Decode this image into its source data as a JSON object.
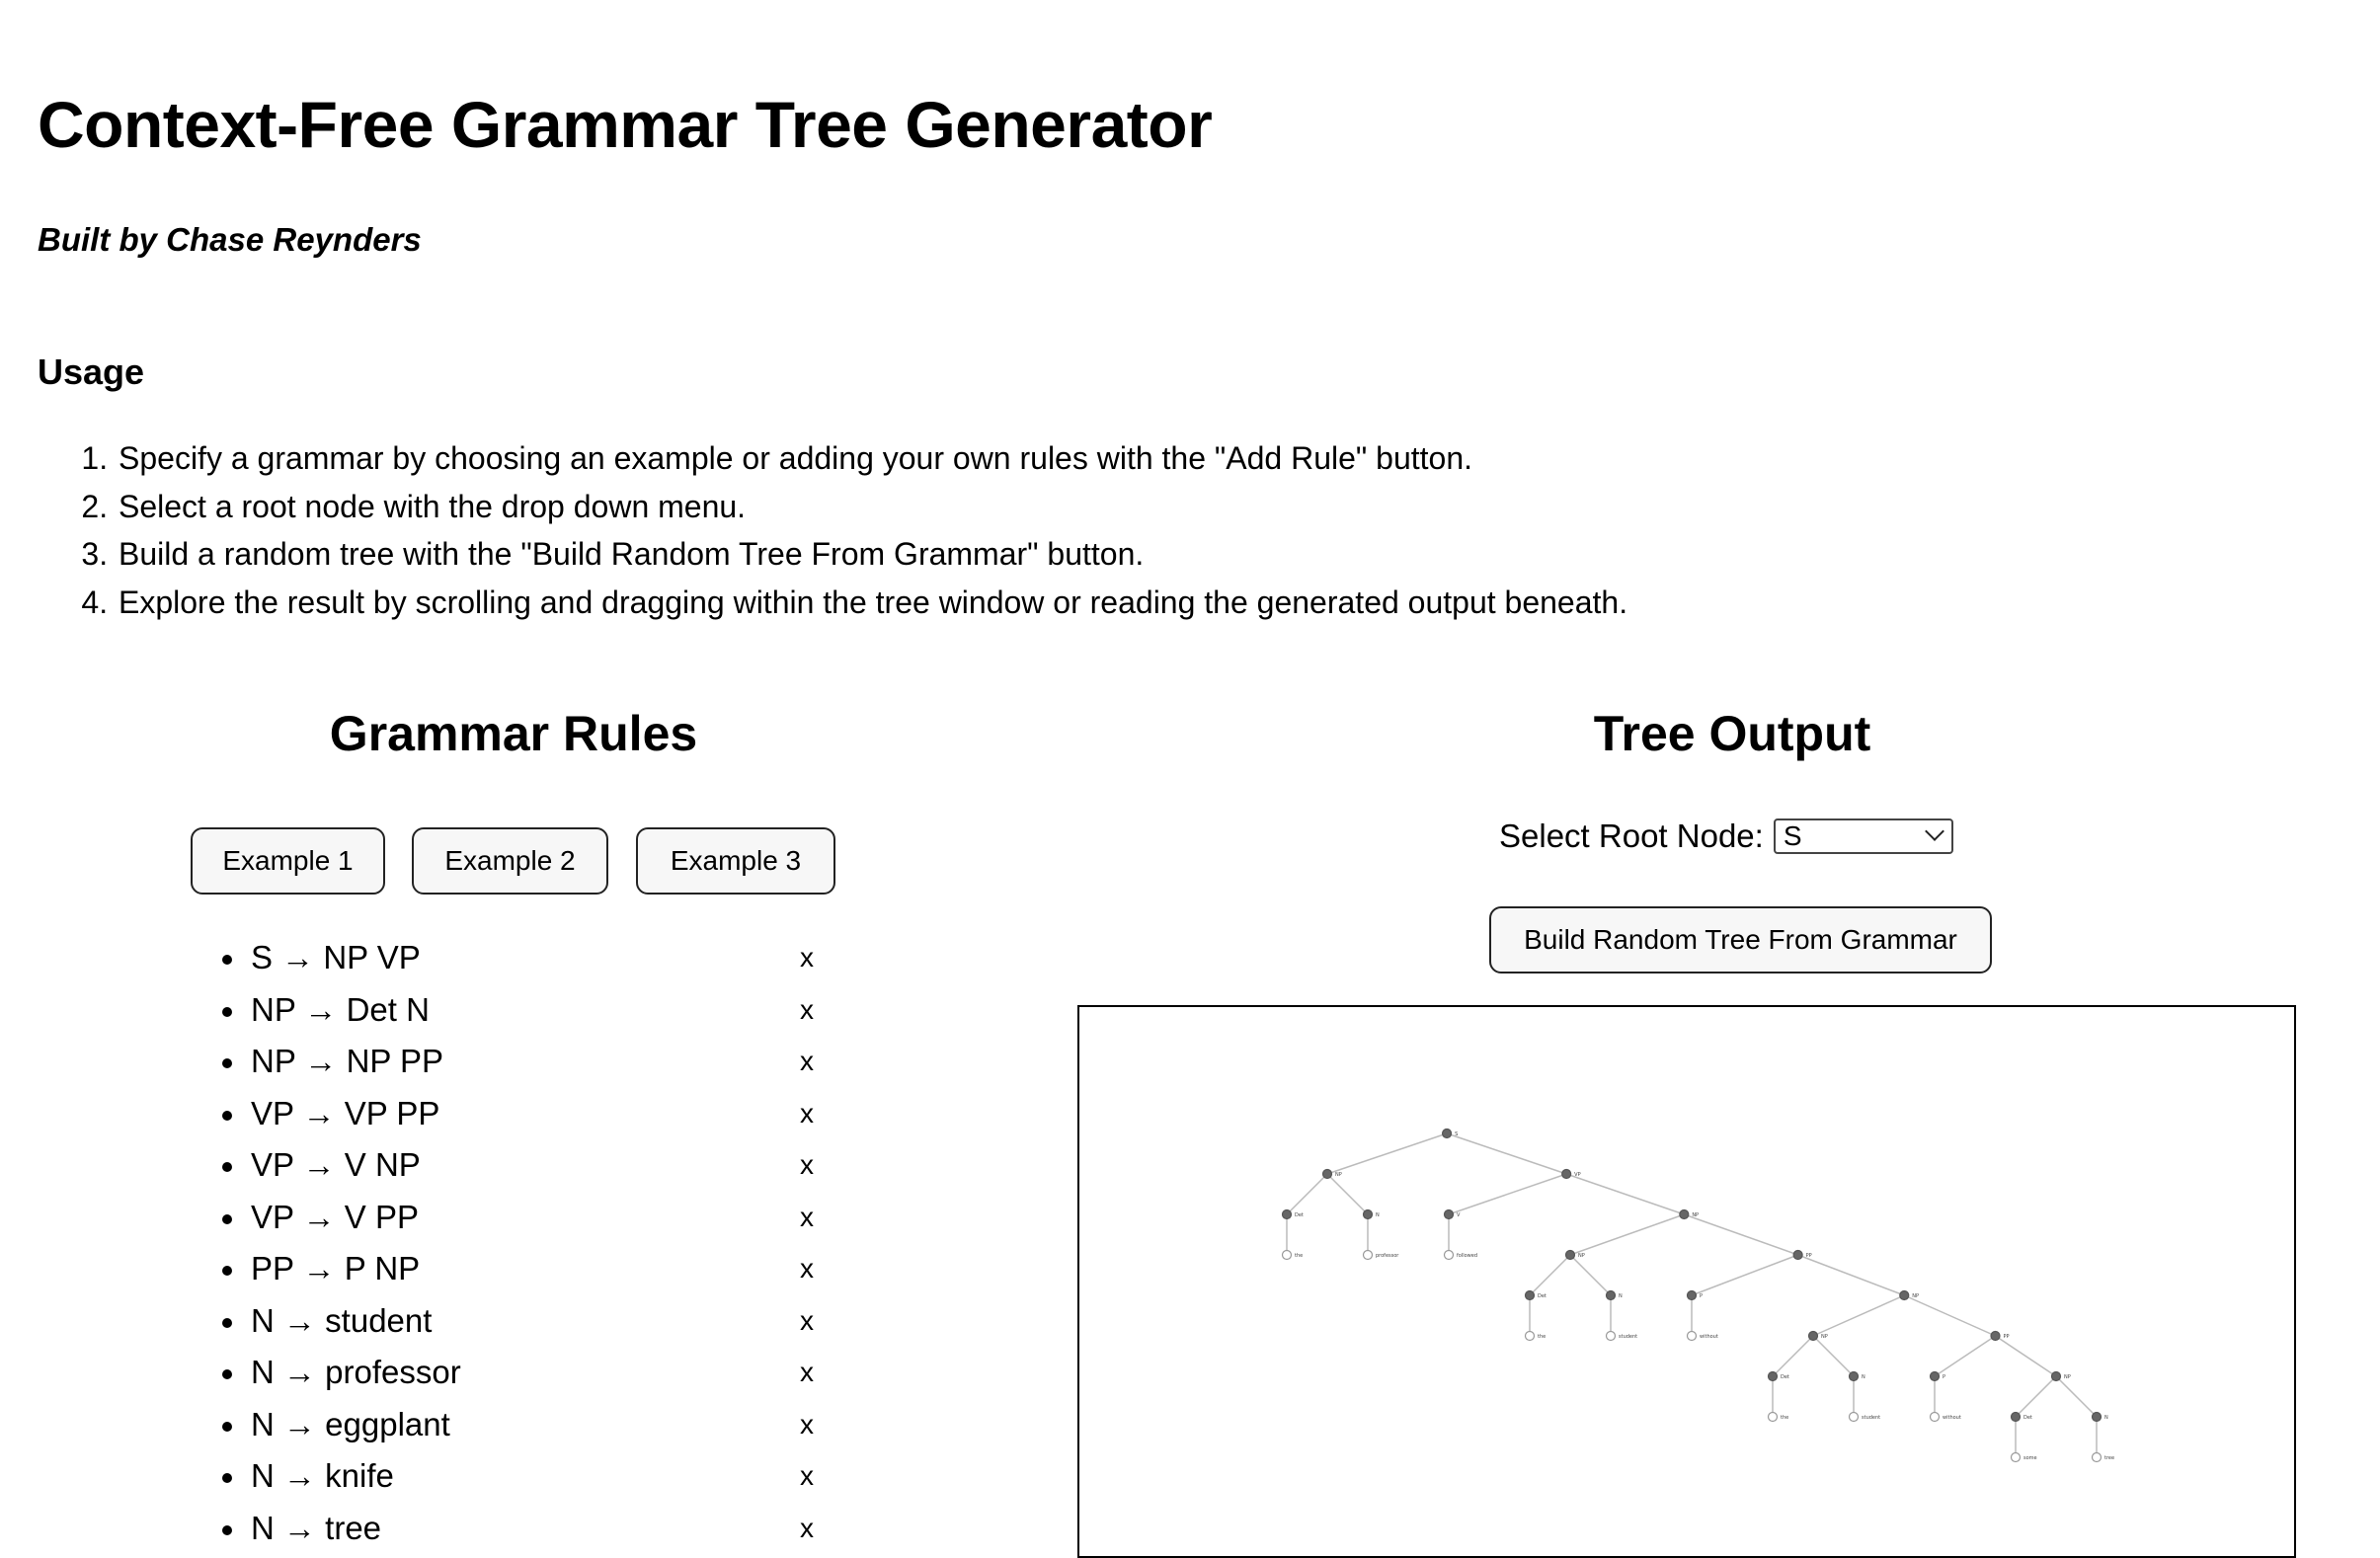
{
  "header": {
    "title": "Context-Free Grammar Tree Generator",
    "byline": "Built by Chase Reynders"
  },
  "usage": {
    "heading": "Usage",
    "steps": [
      "Specify a grammar by choosing an example or adding your own rules with the \"Add Rule\" button.",
      "Select a root node with the drop down menu.",
      "Build a random tree with the \"Build Random Tree From Grammar\" button.",
      "Explore the result by scrolling and dragging within the tree window or reading the generated output beneath."
    ]
  },
  "grammar": {
    "heading": "Grammar Rules",
    "example_buttons": [
      "Example 1",
      "Example 2",
      "Example 3"
    ],
    "remove_label": "x",
    "rules": [
      "S → NP VP",
      "NP → Det N",
      "NP → NP PP",
      "VP → VP PP",
      "VP → V NP",
      "VP → V PP",
      "PP → P NP",
      "N → student",
      "N → professor",
      "N → eggplant",
      "N → knife",
      "N → tree"
    ]
  },
  "tree_output": {
    "heading": "Tree Output",
    "root_label": "Select Root Node:",
    "root_selected": "S",
    "build_button": "Build Random Tree From Grammar",
    "tree": {
      "label": "S",
      "children": [
        {
          "label": "NP",
          "children": [
            {
              "label": "Det",
              "children": [
                {
                  "label": "the"
                }
              ]
            },
            {
              "label": "N",
              "children": [
                {
                  "label": "professor"
                }
              ]
            }
          ]
        },
        {
          "label": "VP",
          "children": [
            {
              "label": "V",
              "children": [
                {
                  "label": "followed"
                }
              ]
            },
            {
              "label": "NP",
              "children": [
                {
                  "label": "NP",
                  "children": [
                    {
                      "label": "Det",
                      "children": [
                        {
                          "label": "the"
                        }
                      ]
                    },
                    {
                      "label": "N",
                      "children": [
                        {
                          "label": "student"
                        }
                      ]
                    }
                  ]
                },
                {
                  "label": "PP",
                  "children": [
                    {
                      "label": "P",
                      "children": [
                        {
                          "label": "without"
                        }
                      ]
                    },
                    {
                      "label": "NP",
                      "children": [
                        {
                          "label": "NP",
                          "children": [
                            {
                              "label": "Det",
                              "children": [
                                {
                                  "label": "the"
                                }
                              ]
                            },
                            {
                              "label": "N",
                              "children": [
                                {
                                  "label": "student"
                                }
                              ]
                            }
                          ]
                        },
                        {
                          "label": "PP",
                          "children": [
                            {
                              "label": "P",
                              "children": [
                                {
                                  "label": "without"
                                }
                              ]
                            },
                            {
                              "label": "NP",
                              "children": [
                                {
                                  "label": "Det",
                                  "children": [
                                    {
                                      "label": "some"
                                    }
                                  ]
                                },
                                {
                                  "label": "N",
                                  "children": [
                                    {
                                      "label": "tree"
                                    }
                                  ]
                                }
                              ]
                            }
                          ]
                        }
                      ]
                    }
                  ]
                }
              ]
            }
          ]
        }
      ]
    }
  }
}
